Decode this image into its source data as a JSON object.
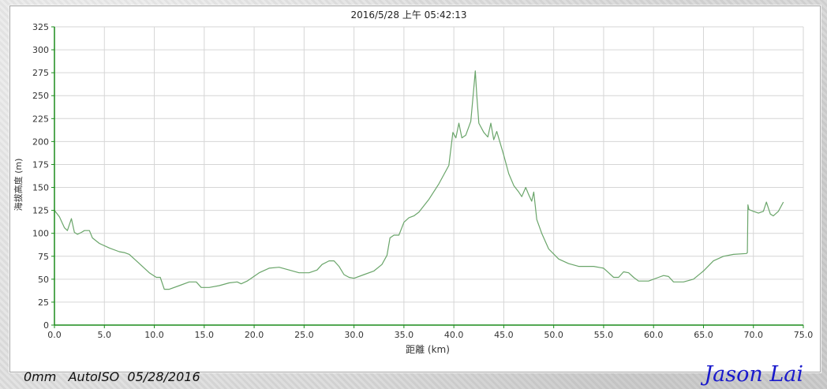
{
  "footer": {
    "camera_info": "0mm   AutoISO  05/28/2016",
    "signature": "Jason Lai"
  },
  "colors": {
    "line": "#6aa56a",
    "axis": "#1c8c1c",
    "grid": "#d6d6d6",
    "text": "#333333",
    "signature": "#1a1acc"
  },
  "chart_data": {
    "type": "line",
    "title": "2016/5/28 上午 05:42:13",
    "xlabel": "距離 (km)",
    "ylabel": "海拔高度 (m)",
    "xlim": [
      0,
      75
    ],
    "ylim": [
      0,
      325
    ],
    "xticks": [
      "0.0",
      "5.0",
      "10.0",
      "15.0",
      "20.0",
      "25.0",
      "30.0",
      "35.0",
      "40.0",
      "45.0",
      "50.0",
      "55.0",
      "60.0",
      "65.0",
      "70.0",
      "75.0"
    ],
    "yticks": [
      "0",
      "25",
      "50",
      "75",
      "100",
      "125",
      "150",
      "175",
      "200",
      "225",
      "250",
      "275",
      "300",
      "325"
    ],
    "grid": true,
    "series": [
      {
        "values": [
          [
            0.0,
            125
          ],
          [
            0.5,
            118
          ],
          [
            1.0,
            106
          ],
          [
            1.3,
            103
          ],
          [
            1.7,
            116
          ],
          [
            2.0,
            101
          ],
          [
            2.3,
            99
          ],
          [
            2.7,
            101
          ],
          [
            3.0,
            103
          ],
          [
            3.5,
            103
          ],
          [
            3.8,
            95
          ],
          [
            4.5,
            89
          ],
          [
            5.5,
            84
          ],
          [
            6.5,
            80
          ],
          [
            7.0,
            79
          ],
          [
            7.5,
            77
          ],
          [
            8.5,
            67
          ],
          [
            9.5,
            57
          ],
          [
            10.2,
            52
          ],
          [
            10.6,
            52
          ],
          [
            11.0,
            39
          ],
          [
            11.5,
            39
          ],
          [
            12.5,
            43
          ],
          [
            13.5,
            47
          ],
          [
            14.2,
            47
          ],
          [
            14.7,
            41
          ],
          [
            15.5,
            41
          ],
          [
            16.5,
            43
          ],
          [
            17.5,
            46
          ],
          [
            18.3,
            47
          ],
          [
            18.7,
            45
          ],
          [
            19.3,
            48
          ],
          [
            20.5,
            57
          ],
          [
            21.5,
            62
          ],
          [
            22.5,
            63
          ],
          [
            23.5,
            60
          ],
          [
            24.5,
            57
          ],
          [
            25.5,
            57
          ],
          [
            26.3,
            60
          ],
          [
            26.8,
            66
          ],
          [
            27.5,
            70
          ],
          [
            28.0,
            70
          ],
          [
            28.5,
            64
          ],
          [
            29.0,
            55
          ],
          [
            29.5,
            52
          ],
          [
            30.0,
            51
          ],
          [
            31.0,
            55
          ],
          [
            32.0,
            59
          ],
          [
            32.8,
            66
          ],
          [
            33.3,
            76
          ],
          [
            33.6,
            95
          ],
          [
            34.0,
            98
          ],
          [
            34.5,
            98
          ],
          [
            35.0,
            112
          ],
          [
            35.5,
            117
          ],
          [
            36.0,
            119
          ],
          [
            36.5,
            123
          ],
          [
            37.5,
            137
          ],
          [
            38.5,
            154
          ],
          [
            39.5,
            174
          ],
          [
            39.9,
            210
          ],
          [
            40.2,
            204
          ],
          [
            40.5,
            220
          ],
          [
            40.8,
            204
          ],
          [
            41.2,
            207
          ],
          [
            41.7,
            222
          ],
          [
            42.0,
            258
          ],
          [
            42.15,
            277
          ],
          [
            42.3,
            250
          ],
          [
            42.5,
            220
          ],
          [
            43.0,
            210
          ],
          [
            43.4,
            205
          ],
          [
            43.7,
            220
          ],
          [
            44.0,
            202
          ],
          [
            44.3,
            211
          ],
          [
            44.6,
            200
          ],
          [
            45.0,
            185
          ],
          [
            45.5,
            165
          ],
          [
            46.0,
            152
          ],
          [
            46.5,
            145
          ],
          [
            46.8,
            140
          ],
          [
            47.2,
            150
          ],
          [
            47.5,
            142
          ],
          [
            47.8,
            135
          ],
          [
            48.0,
            145
          ],
          [
            48.3,
            115
          ],
          [
            48.8,
            100
          ],
          [
            49.5,
            83
          ],
          [
            50.5,
            72
          ],
          [
            51.5,
            67
          ],
          [
            52.5,
            64
          ],
          [
            54.0,
            64
          ],
          [
            55.0,
            62
          ],
          [
            55.5,
            57
          ],
          [
            56.0,
            52
          ],
          [
            56.5,
            52
          ],
          [
            57.0,
            58
          ],
          [
            57.5,
            57
          ],
          [
            58.0,
            52
          ],
          [
            58.5,
            48
          ],
          [
            59.5,
            48
          ],
          [
            60.5,
            52
          ],
          [
            61.0,
            54
          ],
          [
            61.5,
            53
          ],
          [
            62.0,
            47
          ],
          [
            63.0,
            47
          ],
          [
            64.0,
            50
          ],
          [
            65.0,
            59
          ],
          [
            66.0,
            70
          ],
          [
            67.0,
            75
          ],
          [
            68.0,
            77
          ],
          [
            69.3,
            78
          ],
          [
            69.4,
            79
          ],
          [
            69.45,
            131
          ],
          [
            69.55,
            126
          ],
          [
            70.0,
            124
          ],
          [
            70.5,
            122
          ],
          [
            71.0,
            124
          ],
          [
            71.3,
            134
          ],
          [
            71.7,
            121
          ],
          [
            72.0,
            119
          ],
          [
            72.5,
            124
          ],
          [
            73.0,
            134
          ]
        ]
      }
    ]
  }
}
